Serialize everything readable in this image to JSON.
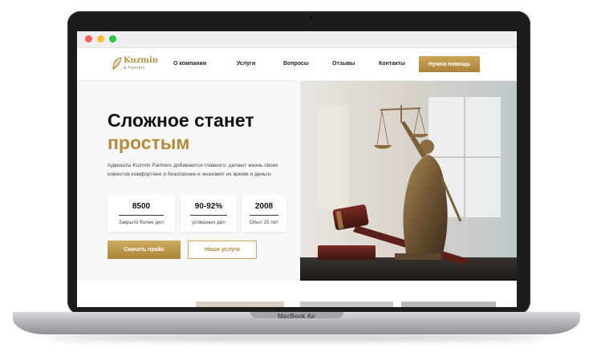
{
  "device": {
    "label": "MacBook Air"
  },
  "header": {
    "logo": {
      "name": "Kuzmin",
      "sub": "& Partners"
    },
    "nav": [
      {
        "label": "О компании"
      },
      {
        "label": "Услуги"
      },
      {
        "label": "Вопросы"
      },
      {
        "label": "Отзывы"
      },
      {
        "label": "Контакты"
      }
    ],
    "cta_label": "Нужна помощь"
  },
  "hero": {
    "title_line1": "Сложное станет",
    "title_line2": "простым",
    "description": "Адвокаты Kuzmin Partners добиваются главного: делают жизнь своих клиентов комфортнее и безопаснее и экономят их время и деньги.",
    "stats": [
      {
        "value": "8500",
        "label": "Закрыто более дел"
      },
      {
        "value": "90-92%",
        "label": "успешных дел"
      },
      {
        "value": "2008",
        "label": "Опыт 15 лет"
      }
    ],
    "primary_button": "Скачать прайс",
    "secondary_button": "Наши услуги"
  },
  "colors": {
    "accent_gold": "#b48a3c",
    "text_dark": "#111111"
  }
}
